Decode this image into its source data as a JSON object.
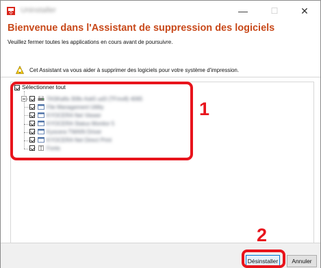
{
  "window": {
    "title": "Uninstaller",
    "controls": {
      "minimize": "—",
      "maximize": "☐",
      "close": "✕"
    }
  },
  "main": {
    "heading": "Bienvenue dans l'Assistant de suppression des logiciels",
    "subheading": "Veuillez fermer toutes les applications en cours avant de poursuivre.",
    "info_text": "Cet Assistant va vous aider à supprimer des logiciels pour votre système d'impression.",
    "info_icon": "warning-lightbulb-icon"
  },
  "tree": {
    "select_all_label": "Sélectionner tout",
    "select_all_checked": true,
    "root": {
      "label": "TASKalfa 308x Ask5 ud3 (TFmv8) 4065",
      "checked": true,
      "icon": "printer-icon"
    },
    "items": [
      {
        "label": "File Management Utility",
        "checked": true,
        "icon": "app-icon"
      },
      {
        "label": "KYOCERA Net Viewer",
        "checked": true,
        "icon": "app-icon"
      },
      {
        "label": "KYOCERA Status Monitor 5",
        "checked": true,
        "icon": "app-icon"
      },
      {
        "label": "Kyocera TWAIN Driver",
        "checked": true,
        "icon": "app-icon"
      },
      {
        "label": "KYOCERA Net Direct Print",
        "checked": true,
        "icon": "app-icon"
      },
      {
        "label": "Fonts",
        "checked": true,
        "icon": "font-icon"
      }
    ]
  },
  "annotations": {
    "callout_1": "1",
    "callout_2": "2",
    "accent_color": "#e8141c"
  },
  "footer": {
    "uninstall_label": "Désinstaller",
    "cancel_label": "Annuler"
  },
  "colors": {
    "heading": "#c8491a",
    "primary_border": "#0078d7"
  }
}
